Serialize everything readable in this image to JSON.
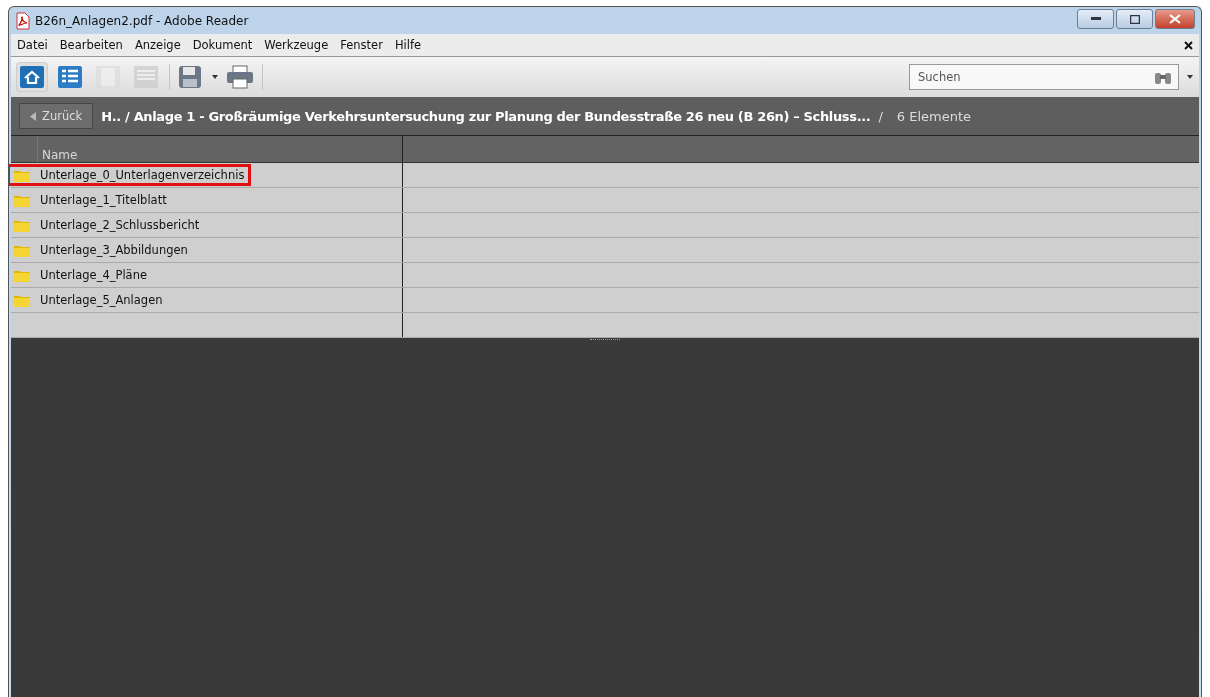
{
  "window": {
    "title": "B26n_Anlagen2.pdf - Adobe Reader"
  },
  "menu": [
    {
      "label": "Datei"
    },
    {
      "label": "Bearbeiten"
    },
    {
      "label": "Anzeige"
    },
    {
      "label": "Dokument"
    },
    {
      "label": "Werkzeuge"
    },
    {
      "label": "Fenster"
    },
    {
      "label": "Hilfe"
    }
  ],
  "toolbar": {
    "tools": [
      {
        "kind": "home",
        "selected": true,
        "disabled": false
      },
      {
        "kind": "list",
        "selected": false,
        "disabled": false
      },
      {
        "kind": "page",
        "selected": false,
        "disabled": true
      },
      {
        "kind": "panel",
        "selected": false,
        "disabled": true
      }
    ],
    "search": {
      "placeholder": "Suchen"
    }
  },
  "breadcrumb": {
    "back": "Zurück",
    "path": "H.. / Anlage 1 - Großräumige Verkehrsuntersuchung zur Planung der Bundesstraße 26 neu (B 26n) – Schluss...",
    "separator": "/",
    "count": "6 Elemente"
  },
  "table": {
    "columns": [
      "Name"
    ],
    "rows": [
      {
        "name": "Unterlage_0_Unterlagenverzeichnis",
        "highlighted": true
      },
      {
        "name": "Unterlage_1_Titelblatt",
        "highlighted": false
      },
      {
        "name": "Unterlage_2_Schlussbericht",
        "highlighted": false
      },
      {
        "name": "Unterlage_3_Abbildungen",
        "highlighted": false
      },
      {
        "name": "Unterlage_4_Pläne",
        "highlighted": false
      },
      {
        "name": "Unterlage_5_Anlagen",
        "highlighted": false
      }
    ]
  }
}
